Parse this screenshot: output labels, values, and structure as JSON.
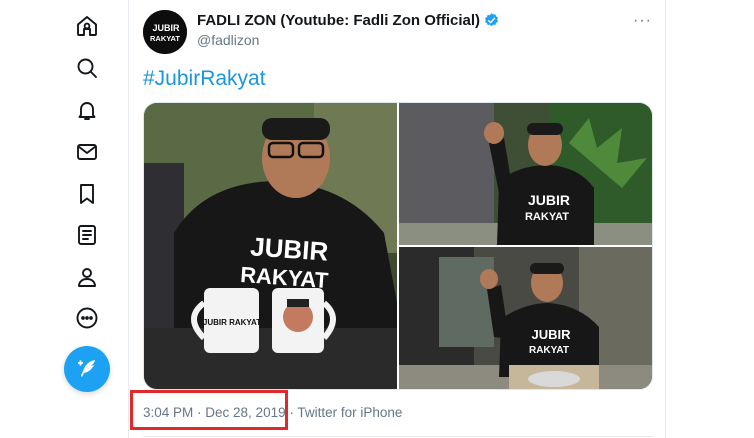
{
  "sidebar": {
    "icons": [
      "home-icon",
      "search-icon",
      "notifications-icon",
      "messages-icon",
      "bookmarks-icon",
      "lists-icon",
      "profile-icon",
      "more-icon"
    ],
    "compose_icon": "compose-tweet-icon"
  },
  "tweet": {
    "display_name": "FADLI ZON (Youtube: Fadli Zon Official)",
    "handle": "@fadlizon",
    "more_label": "···",
    "text": "#JubirRakyat",
    "avatar_text_1": "JUBIR",
    "avatar_text_2": "RAKYAT",
    "photos": [
      {
        "shirt_line1": "JUBIR",
        "shirt_line2": "RAKYAT",
        "mug_label": "JUBIR RAKYAT"
      },
      {
        "shirt_line1": "JUBIR",
        "shirt_line2": "RAKYAT"
      },
      {
        "shirt_line1": "JUBIR",
        "shirt_line2": "RAKYAT"
      }
    ],
    "time": "3:04 PM",
    "separator": " · ",
    "date": "Dec 28, 2019",
    "separator2": " · ",
    "source": "Twitter for iPhone"
  },
  "colors": {
    "accent": "#1da1f2",
    "hashtag": "#1b95e0",
    "highlight": "#e3282c",
    "secondary_text": "#657786"
  }
}
